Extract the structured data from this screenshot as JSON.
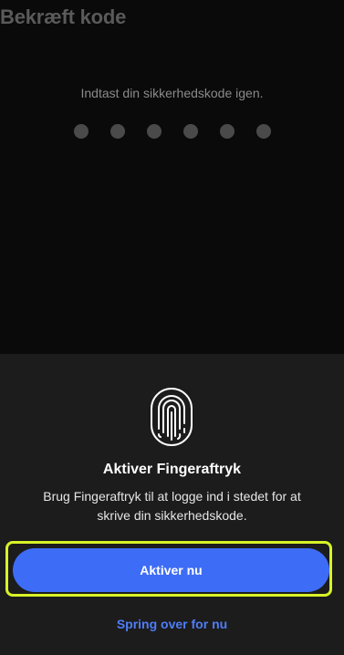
{
  "header": {
    "title": "Bekræft kode"
  },
  "passcode": {
    "prompt": "Indtast din sikkerhedskode igen.",
    "dot_count": 6
  },
  "fingerprint_sheet": {
    "icon": "fingerprint-icon",
    "title": "Aktiver Fingeraftryk",
    "description": "Brug Fingeraftryk til at logge ind i stedet for at skrive din sikkerhedskode.",
    "primary_button": "Aktiver nu",
    "secondary_link": "Spring over for nu"
  },
  "colors": {
    "background": "#0a0a0a",
    "sheet": "#1c1c1c",
    "accent_button": "#3d6cf6",
    "link": "#4f7df8",
    "highlight_outline": "#d8f227"
  }
}
